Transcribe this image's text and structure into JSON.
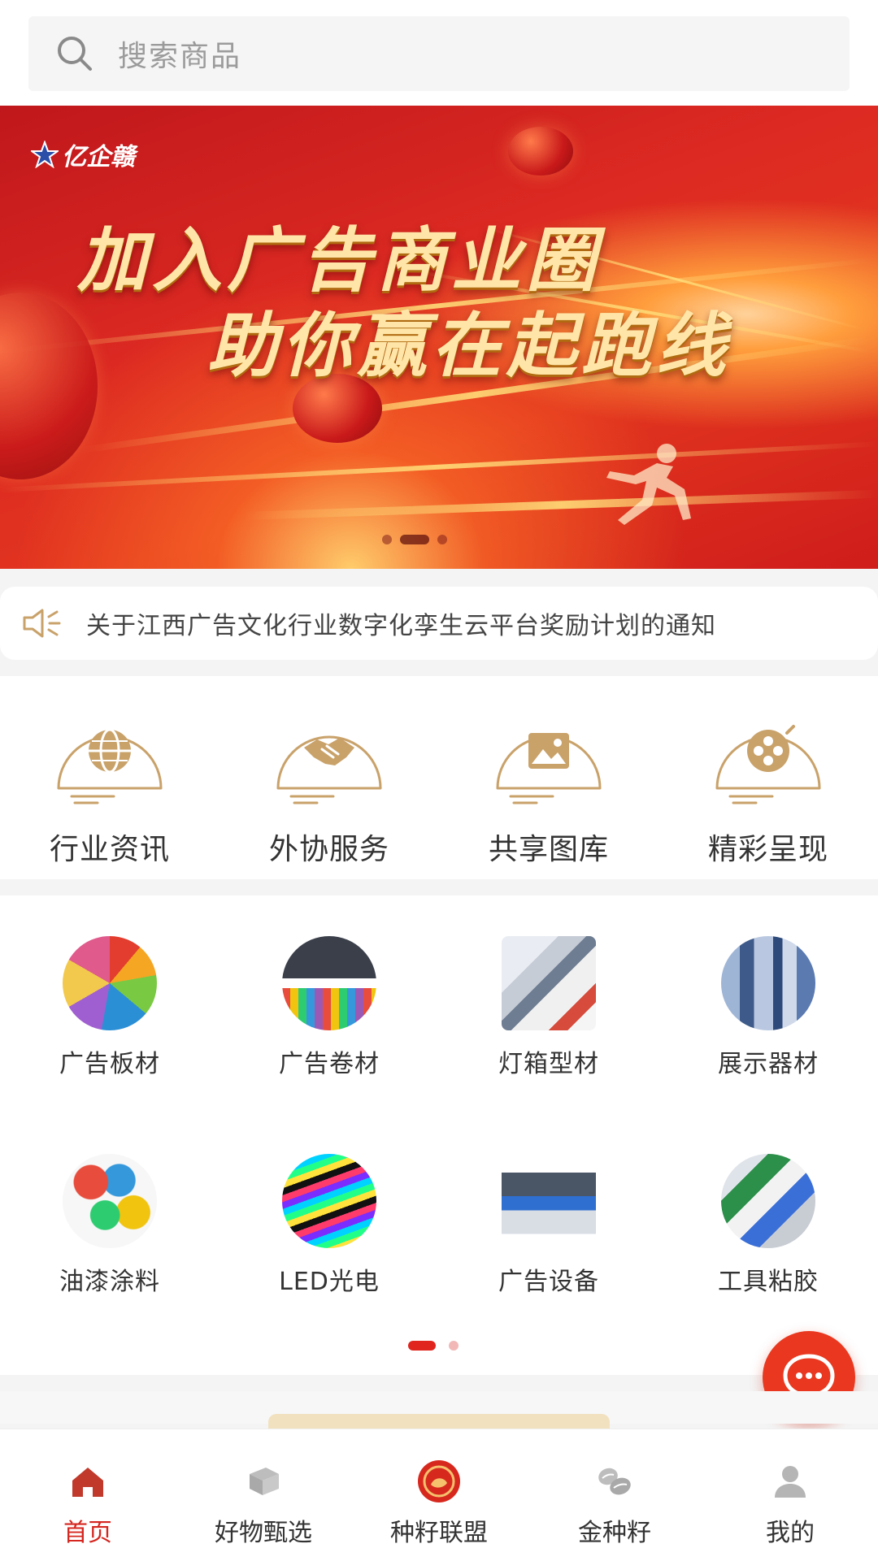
{
  "search": {
    "placeholder": "搜索商品",
    "icon": "search-icon"
  },
  "banner": {
    "logo_text": "亿企赣",
    "line1": "加入广告商业圈",
    "line2": "助你赢在起跑线",
    "slides": 3,
    "active_slide": 2
  },
  "notice": {
    "icon": "speaker-icon",
    "text": "关于江西广告文化行业数字化孪生云平台奖励计划的通知"
  },
  "services": [
    {
      "label": "行业资讯",
      "icon": "globe-icon"
    },
    {
      "label": "外协服务",
      "icon": "handshake-icon"
    },
    {
      "label": "共享图库",
      "icon": "image-icon"
    },
    {
      "label": "精彩呈现",
      "icon": "film-reel-icon"
    }
  ],
  "categories": [
    {
      "label": "广告板材",
      "icon": "sheet-material-thumb"
    },
    {
      "label": "广告卷材",
      "icon": "roll-material-thumb"
    },
    {
      "label": "灯箱型材",
      "icon": "lightbox-profile-thumb"
    },
    {
      "label": "展示器材",
      "icon": "display-stand-thumb"
    },
    {
      "label": "油漆涂料",
      "icon": "paint-thumb"
    },
    {
      "label": "LED光电",
      "icon": "led-thumb"
    },
    {
      "label": "广告设备",
      "icon": "printer-thumb"
    },
    {
      "label": "工具粘胶",
      "icon": "tools-thumb"
    }
  ],
  "category_pages": {
    "total": 2,
    "active": 1
  },
  "fab": {
    "icon": "chat-bubble-icon"
  },
  "tabbar": [
    {
      "label": "首页",
      "icon": "home-icon",
      "active": true
    },
    {
      "label": "好物甄选",
      "icon": "box-icon",
      "active": false
    },
    {
      "label": "种籽联盟",
      "icon": "alliance-logo-icon",
      "active": false
    },
    {
      "label": "金种籽",
      "icon": "seeds-icon",
      "active": false
    },
    {
      "label": "我的",
      "icon": "user-icon",
      "active": false
    }
  ],
  "colors": {
    "accent": "#d5261f",
    "gold": "#c9a26a",
    "fab": "#e9381f"
  }
}
